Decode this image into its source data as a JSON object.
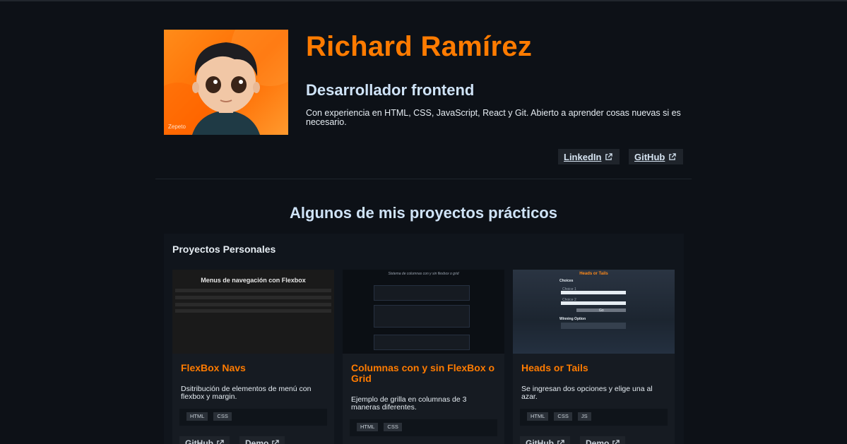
{
  "profile": {
    "name": "Richard Ramírez",
    "role": "Desarrollador frontend",
    "bio": "Con experiencia en HTML, CSS, JavaScript, React y Git. Abierto a aprender cosas nuevas si es necesario.",
    "avatar_watermark": "Zepeto",
    "links": [
      {
        "label": "LinkedIn",
        "icon": "external-link-icon"
      },
      {
        "label": "GitHub",
        "icon": "external-link-icon"
      }
    ]
  },
  "projects_section": {
    "title": "Algunos de mis proyectos prácticos",
    "panel_title": "Proyectos Personales",
    "cards": [
      {
        "title": "FlexBox Navs",
        "description": "Dsitribución de elementos de menú con flexbox y margin.",
        "tags": [
          "HTML",
          "CSS"
        ],
        "buttons": [
          "GitHub",
          "Demo"
        ],
        "thumb_heading": "Menus de navegación con Flexbox"
      },
      {
        "title": "Columnas con y sin FlexBox o Grid",
        "description": "Ejemplo de grilla en columnas de 3 maneras diferentes.",
        "tags": [
          "HTML",
          "CSS"
        ],
        "buttons": [
          "GitHub",
          "Demo"
        ],
        "thumb_heading": "Sistema de columnas con y sin flexbox o grid"
      },
      {
        "title": "Heads or Tails",
        "description": "Se ingresan dos opciones y elige una al azar.",
        "tags": [
          "HTML",
          "CSS",
          "JS"
        ],
        "buttons": [
          "GitHub",
          "Demo"
        ],
        "thumb_heading": "Heads or Tails",
        "thumb_subheading": "Choices",
        "thumb_label_1": "Choice 1",
        "thumb_label_2": "Choice 2",
        "thumb_button": "Go",
        "thumb_section": "Winning Option"
      }
    ]
  },
  "colors": {
    "background": "#0d1117",
    "accent": "#ff7b00",
    "heading": "#cfe3f7"
  }
}
